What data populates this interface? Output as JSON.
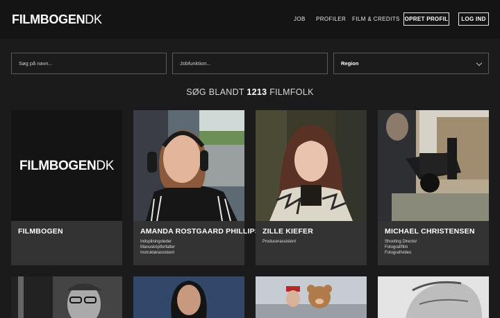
{
  "brand": {
    "bold": "FILMBOGEN",
    "light": "DK"
  },
  "nav": {
    "links": [
      "JOB",
      "PROFILER",
      "FILM & CREDITS"
    ],
    "create_profile": "OPRET PROFIL",
    "login": "LOG IND"
  },
  "search": {
    "name_placeholder": "Søg på navn...",
    "job_placeholder": "Jobfunktion...",
    "region_label": "Region"
  },
  "count": {
    "prefix": "SØG BLANDT",
    "number": "1213",
    "suffix": "FILMFOLK"
  },
  "profiles": [
    {
      "name": "FILMBOGEN",
      "roles": []
    },
    {
      "name": "AMANDA ROSTGAARD PHILLIPSEN",
      "roles": [
        "Indspilningsleder",
        "Manuskriptforfatter",
        "Instruktørassistent"
      ]
    },
    {
      "name": "ZILLE KIEFER",
      "roles": [
        "Producerassistent"
      ]
    },
    {
      "name": "MICHAEL CHRISTENSEN",
      "roles": [
        "Shooting Director",
        "Fotograf/film",
        "Fotograf/video"
      ]
    }
  ],
  "colors": {
    "background": "#1b1b1b",
    "header": "#141414",
    "card": "#333333",
    "border": "#5a5a5a"
  }
}
